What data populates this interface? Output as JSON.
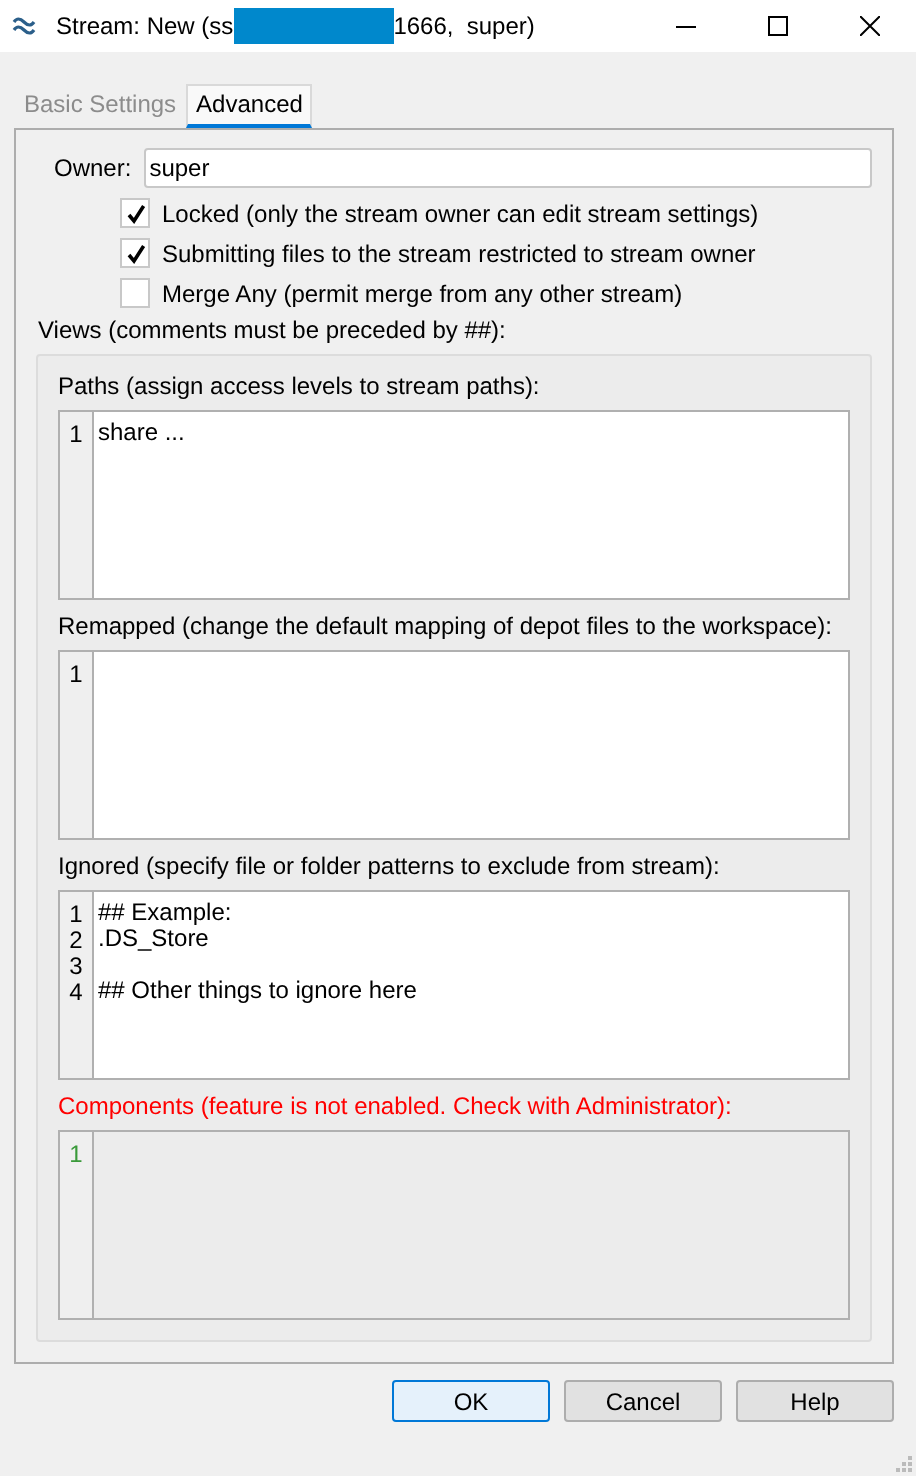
{
  "window": {
    "title_start": "Stream: New (ss",
    "title_redacted": true,
    "title_end": "1666,  super)"
  },
  "tabs": [
    {
      "label": "Basic Settings",
      "selected": false
    },
    {
      "label": "Advanced",
      "selected": true
    }
  ],
  "owner": {
    "label": "Owner:",
    "value": "super"
  },
  "options": [
    {
      "label": "Locked (only the stream owner can edit stream settings)",
      "checked": true
    },
    {
      "label": "Submitting files to the stream restricted to stream owner",
      "checked": true
    },
    {
      "label": "Merge Any (permit merge from any other stream)",
      "checked": false
    }
  ],
  "views": {
    "label": "Views (comments must be preceded by ##):",
    "sections": [
      {
        "label": "Paths (assign access levels to stream paths):",
        "disabled": false,
        "lines": [
          {
            "number": "1",
            "text": "share ..."
          }
        ]
      },
      {
        "label": "Remapped (change the default mapping of depot files to the workspace):",
        "disabled": false,
        "lines": [
          {
            "number": "1"
          }
        ]
      },
      {
        "label": "Ignored (specify file or folder patterns to exclude from stream):",
        "disabled": false,
        "lines": [
          {
            "number": "1",
            "text": "## Example:"
          },
          {
            "number": "2",
            "text": ".DS_Store"
          },
          {
            "number": "3"
          },
          {
            "number": "4",
            "text": "## Other things to ignore here"
          }
        ]
      },
      {
        "label": "Components (feature is not enabled. Check with Administrator):",
        "disabled": true,
        "lines": [
          {
            "number": "1"
          }
        ]
      }
    ]
  },
  "buttons": [
    {
      "label": "OK",
      "default": true
    },
    {
      "label": "Cancel",
      "default": false
    },
    {
      "label": "Help",
      "default": false
    }
  ]
}
